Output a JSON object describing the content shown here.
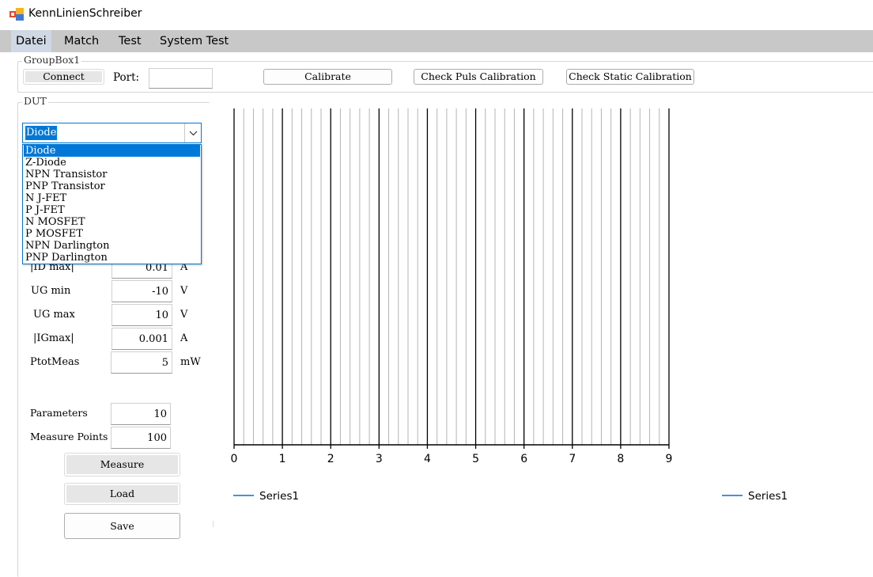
{
  "window": {
    "title": "KennLinienSchreiber"
  },
  "menu": {
    "items": [
      "Datei",
      "Match",
      "Test",
      "System Test"
    ],
    "active_index": 0
  },
  "groupbox1": {
    "label": "GroupBox1",
    "connect_label": "Connect",
    "port_label": "Port:",
    "port_value": "",
    "calibrate_label": "Calibrate",
    "check_puls_label": "Check Puls Calibration",
    "check_static_label": "Check Static Calibration"
  },
  "dut": {
    "label": "DUT",
    "selected": "Diode",
    "options": [
      "Diode",
      "Z-Diode",
      "NPN Transistor",
      "PNP Transistor",
      "N J-FET",
      "P J-FET",
      "N MOSFET",
      "P MOSFET",
      "NPN Darlington",
      "PNP Darlington"
    ],
    "selected_index": 0,
    "params": [
      {
        "label": "|ID max|",
        "value": "0.01",
        "unit": "A"
      },
      {
        "label": "UG min",
        "value": "-10",
        "unit": "V"
      },
      {
        "label": "UG max",
        "value": "10",
        "unit": "V"
      },
      {
        "label": "|IGmax|",
        "value": "0.001",
        "unit": "A"
      },
      {
        "label": "PtotMeas",
        "value": "5",
        "unit": "mW"
      }
    ],
    "parameters_label": "Parameters",
    "parameters_value": "10",
    "measure_points_label": "Measure Points",
    "measure_points_value": "100",
    "measure_label": "Measure",
    "load_label": "Load",
    "save_label": "Save"
  },
  "colors": {
    "accent": "#0078d7",
    "series": "#4a90d9",
    "menubar": "#c8c8c8"
  },
  "chart_data": {
    "type": "line",
    "xlim": [
      0,
      9
    ],
    "xticks": [
      "0",
      "1",
      "2",
      "3",
      "4",
      "5",
      "6",
      "7",
      "8",
      "9"
    ],
    "minor_per_major": 5,
    "grid": true,
    "series": [
      {
        "name": "Series1",
        "values": []
      }
    ],
    "legend": [
      "Series1",
      "Series1"
    ]
  }
}
